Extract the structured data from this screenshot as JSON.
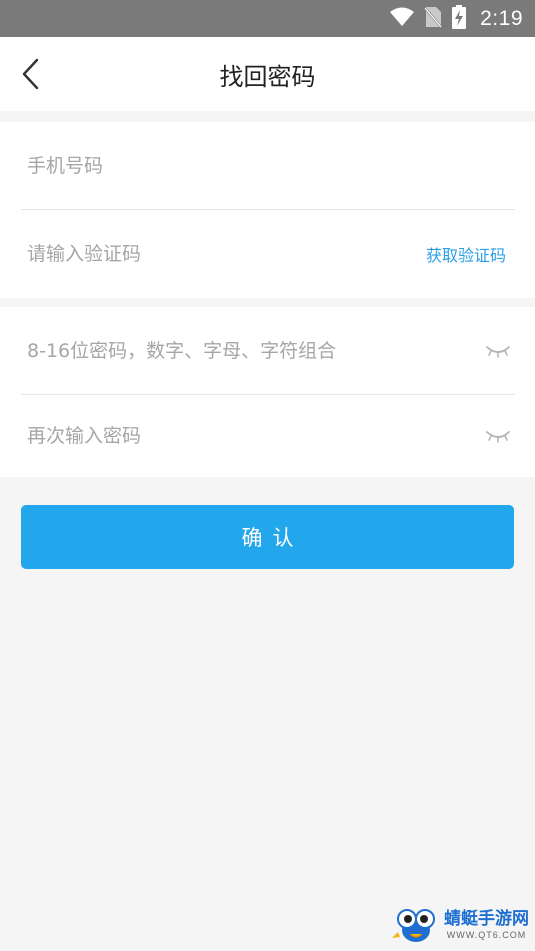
{
  "status_bar": {
    "time": "2:19",
    "icons": [
      "wifi-icon",
      "no-sim-icon",
      "battery-charging-icon"
    ]
  },
  "header": {
    "title": "找回密码",
    "back_icon": "chevron-left-icon"
  },
  "form": {
    "phone_placeholder": "手机号码",
    "code_placeholder": "请输入验证码",
    "get_code_label": "获取验证码",
    "password_placeholder": "8-16位密码，数字、字母、字符组合",
    "confirm_password_placeholder": "再次输入密码",
    "eye_icon": "eye-closed-icon"
  },
  "confirm_label": "确认",
  "watermark": {
    "name": "蜻蜓手游网",
    "url": "WWW.QT6.COM"
  },
  "colors": {
    "accent": "#23a7ec",
    "link": "#2b9ee8",
    "status_bar": "#7a7a7a",
    "background": "#f5f5f5"
  }
}
